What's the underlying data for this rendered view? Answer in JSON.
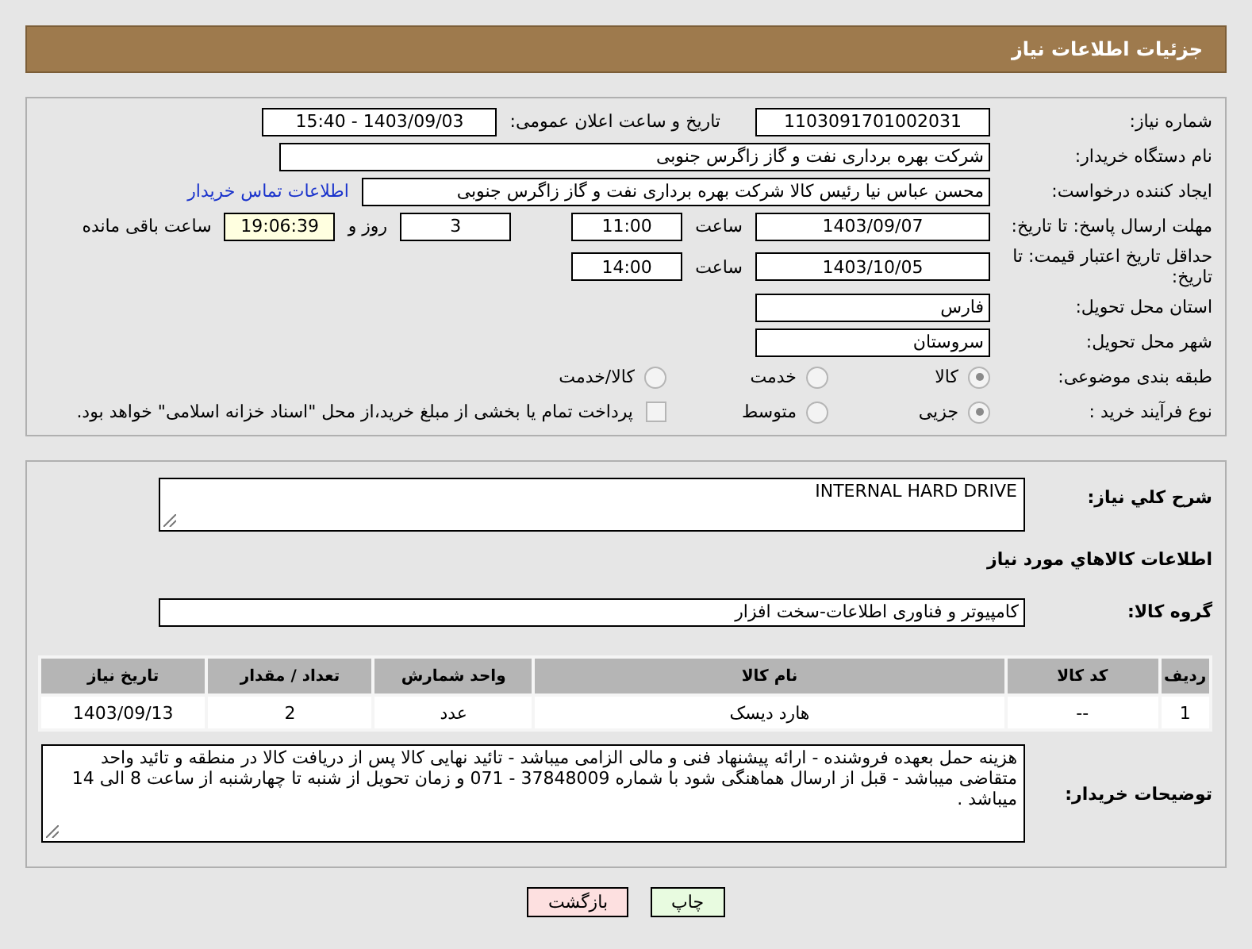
{
  "header": {
    "title": "جزئیات اطلاعات نیاز"
  },
  "need_number": {
    "label": "شماره نیاز:",
    "value": "1103091701002031"
  },
  "announce": {
    "label": "تاریخ و ساعت اعلان عمومی:",
    "value": "1403/09/03 - 15:40"
  },
  "buyer_org": {
    "label": "نام دستگاه خریدار:",
    "value": "شرکت بهره برداری نفت و گاز زاگرس جنوبی"
  },
  "requester": {
    "label": "ایجاد کننده درخواست:",
    "value": "محسن عباس نیا رئیس کالا شرکت بهره برداری نفت و گاز زاگرس جنوبی",
    "link": "اطلاعات تماس خریدار"
  },
  "response_deadline": {
    "label": "مهلت ارسال پاسخ: تا تاریخ:",
    "date": "1403/09/07",
    "time_label": "ساعت",
    "time": "11:00",
    "days": "3",
    "days_label": "روز و",
    "remaining": "19:06:39",
    "remaining_label": "ساعت باقی مانده"
  },
  "price_validity": {
    "label": "حداقل تاریخ اعتبار قیمت: تا تاریخ:",
    "date": "1403/10/05",
    "time_label": "ساعت",
    "time": "14:00"
  },
  "province": {
    "label": "استان محل تحویل:",
    "value": "فارس"
  },
  "city": {
    "label": "شهر محل تحویل:",
    "value": "سروستان"
  },
  "category": {
    "label": "طبقه بندی موضوعی:",
    "options": [
      {
        "label": "کالا",
        "selected": true
      },
      {
        "label": "خدمت",
        "selected": false
      },
      {
        "label": "کالا/خدمت",
        "selected": false
      }
    ]
  },
  "process": {
    "label": "نوع فرآیند خرید :",
    "options": [
      {
        "label": "جزیی",
        "selected": true
      },
      {
        "label": "متوسط",
        "selected": false
      }
    ],
    "payment": {
      "label": "پرداخت تمام یا بخشی از مبلغ خرید،از محل \"اسناد خزانه اسلامی\" خواهد بود.",
      "checked": false
    }
  },
  "description": {
    "label": "شرح کلي نياز:",
    "value": "INTERNAL HARD DRIVE"
  },
  "items_title": "اطلاعات کالاهاي مورد نياز",
  "goods_group": {
    "label": "گروه کالا:",
    "value": "کامپیوتر و فناوری اطلاعات-سخت افزار"
  },
  "table": {
    "columns": [
      "ردیف",
      "کد کالا",
      "نام کالا",
      "واحد شمارش",
      "تعداد / مقدار",
      "تاریخ نیاز"
    ],
    "rows": [
      [
        "1",
        "--",
        "هارد دیسک",
        "عدد",
        "2",
        "1403/09/13"
      ]
    ]
  },
  "buyer_notes": {
    "label": "توضیحات خریدار:",
    "value": "هزینه حمل بعهده فروشنده - ارائه پیشنهاد فنی و مالی الزامی میباشد - تائید نهایی کالا پس از دریافت کالا در منطقه و تائید واحد متقاضی میباشد - قبل از ارسال هماهنگی شود با شماره 37848009 - 071 و زمان تحویل از شنبه تا چهارشنبه از ساعت 8 الی 14 میباشد ."
  },
  "buttons": [
    {
      "label": "چاپ",
      "kind": "print"
    },
    {
      "label": "بازگشت",
      "kind": "back"
    }
  ]
}
